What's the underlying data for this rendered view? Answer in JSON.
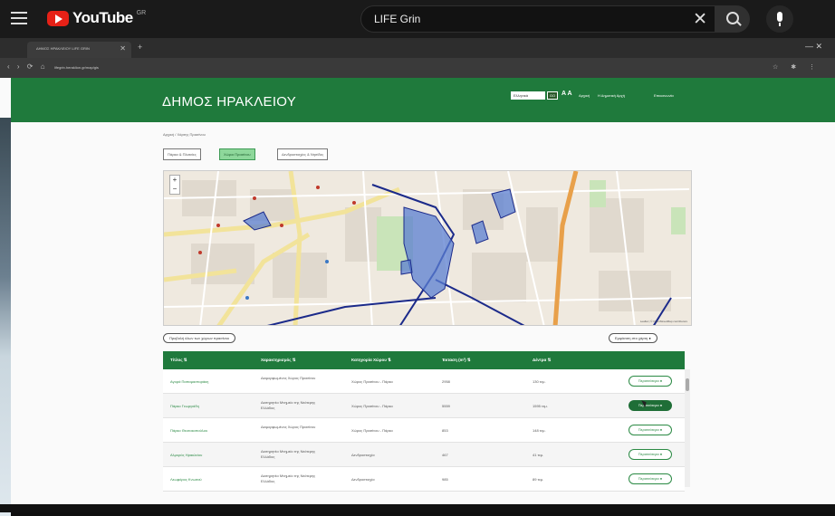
{
  "youtube": {
    "logo_text": "YouTube",
    "logo_sup": "GR",
    "search_value": "LIFE Grin",
    "clear_symbol": "✕"
  },
  "browser": {
    "tab_title": "ΔΗΜΟΣ ΗΡΑΚΛΕΙΟΥ LIFE GRIN",
    "tab_close": "✕",
    "tab_plus": "+",
    "url": "lifegrin.heraklion.gr/map/gis",
    "window_controls": "— ✕",
    "nav_arrows": "‹ › ⟳ ⌂",
    "ext_icons": "☆ ✱ ⋮"
  },
  "site": {
    "title": "ΔΗΜΟΣ ΗΡΑΚΛΕΙΟΥ",
    "lang_value": "Ελληνικά",
    "lang_go": "GO",
    "a11y": "A A",
    "links": [
      "Αρχική",
      "Η Δημοτική Αρχή",
      "Επικοινωνία"
    ],
    "breadcrumb": "Αρχική / Χάρτης Πρασίνου",
    "filters": [
      "Πάρκα & Πλατείες",
      "Χώροι Πρασίνου",
      "Δενδροστοιχίες & Νησίδες"
    ],
    "map_attr": "Leaflet | © OpenStreetMap contributors",
    "zoom_in": "+",
    "zoom_out": "−",
    "pill_left": "Προβολή όλων των χώρων πρασίνου",
    "pill_right": "Εμφάνιση στο χάρτη ●"
  },
  "table": {
    "headers": [
      "Τίτλος ⇅",
      "Χαρακτηρισμός ⇅",
      "Κατηγορία Χώρου ⇅",
      "Έκταση (m²) ⇅",
      "Δέντρα ⇅"
    ],
    "rows": [
      {
        "title": "Αγορά Παπαμαστοράκη",
        "type": "Διαμορφωμένος Χώρος Πρασίνου",
        "category": "Χώρος Πρασίνου - Πάρκο",
        "area": "2958",
        "trees": "130 τεμ.",
        "highlight": false
      },
      {
        "title": "Πάρκο Γεωργιάδη",
        "type": "Διατηρητέο Μνημείο της Νεότερης Ελλάδας",
        "category": "Χώρος Πρασίνου - Πάρκο",
        "area": "5559",
        "trees": "1595 τεμ.",
        "highlight": true
      },
      {
        "title": "Πάρκο Θεοτοκοπούλου",
        "type": "Διαμορφωμένος Χώρος Πρασίνου",
        "category": "Χώρος Πρασίνου - Πάρκο",
        "area": "853",
        "trees": "148 τεμ.",
        "highlight": false
      },
      {
        "title": "Αλμυρός Ηρακλείου",
        "type": "Διατηρητέο Μνημείο της Νεότερης Ελλάδας",
        "category": "Δενδροστοιχία",
        "area": "467",
        "trees": "41 τεμ.",
        "highlight": false
      },
      {
        "title": "Λεωφόρος Κνωσού",
        "type": "Διατηρητέο Μνημείο της Νεότερης Ελλάδας",
        "category": "Δενδροστοιχία",
        "area": "985",
        "trees": "89 τεμ.",
        "highlight": false
      }
    ],
    "button_label": "Περισσότερα ●"
  }
}
